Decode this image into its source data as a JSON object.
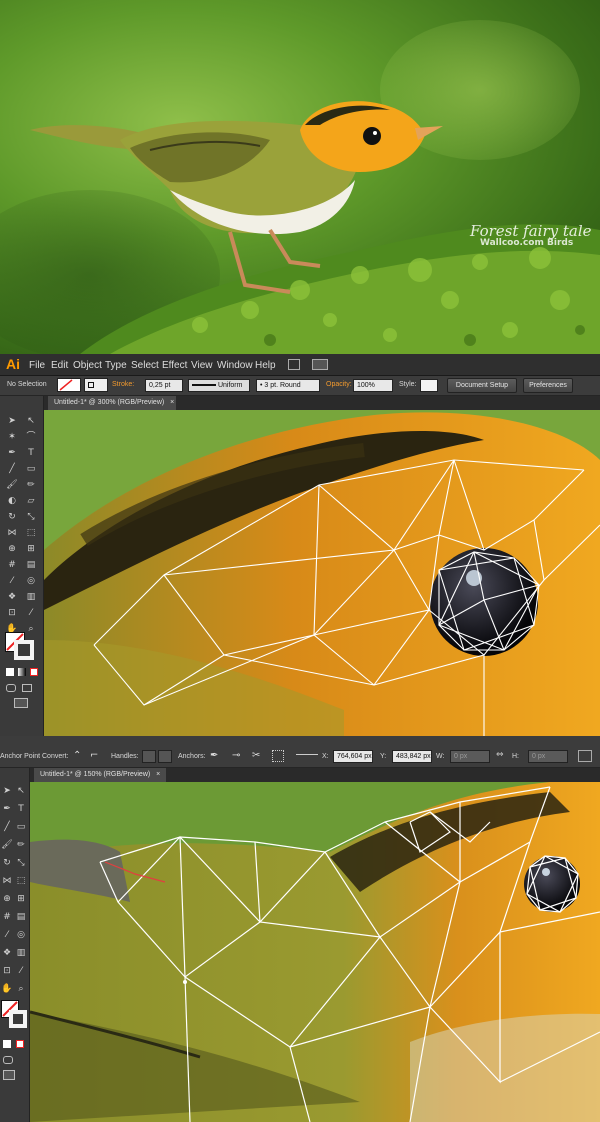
{
  "photo": {
    "watermark_title": "Forest fairy tale",
    "watermark_sub": "Wallcoo.com Birds"
  },
  "window1": {
    "logo": "Ai",
    "menu": [
      "File",
      "Edit",
      "Object",
      "Type",
      "Select",
      "Effect",
      "View",
      "Window",
      "Help"
    ],
    "control": {
      "selection_label": "No Selection",
      "stroke_label": "Stroke:",
      "stroke_value": "0,25 pt",
      "profile": "Uniform",
      "brush": "3 pt. Round",
      "opacity_label": "Opacity:",
      "opacity_value": "100%",
      "style_label": "Style:",
      "document_setup": "Document Setup",
      "preferences": "Preferences"
    },
    "doc_tab": "Untitled-1* @ 300% (RGB/Preview)",
    "close": "×"
  },
  "window2": {
    "control": {
      "tool_label": "Anchor Point",
      "convert_label": "Convert:",
      "handles_label": "Handles:",
      "anchors_label": "Anchors:",
      "x_label": "X:",
      "x_value": "764,604 px",
      "y_label": "Y:",
      "y_value": "483,842 px",
      "w_label": "W:",
      "w_value": "0 px",
      "h_label": "H:",
      "h_value": "0 px"
    },
    "doc_tab": "Untitled-1* @ 150% (RGB/Preview)",
    "close": "×"
  },
  "colors": {
    "illustrator_orange": "#ff9a00",
    "panel_dark": "#3a3a3a",
    "mesh_stroke": "#ffffff"
  },
  "icons": [
    "selection-tool-icon",
    "direct-selection-icon",
    "magic-wand-icon",
    "lasso-icon",
    "pen-icon",
    "type-icon",
    "line-icon",
    "rectangle-icon",
    "paintbrush-icon",
    "pencil-icon",
    "blob-brush-icon",
    "eraser-icon",
    "rotate-icon",
    "scale-icon",
    "width-icon",
    "free-transform-icon",
    "shape-builder-icon",
    "perspective-icon",
    "mesh-icon",
    "gradient-icon",
    "eyedropper-icon",
    "blend-icon",
    "symbol-sprayer-icon",
    "graph-icon",
    "artboard-icon",
    "slice-icon",
    "hand-icon",
    "zoom-icon",
    "fill-stroke-icon"
  ]
}
